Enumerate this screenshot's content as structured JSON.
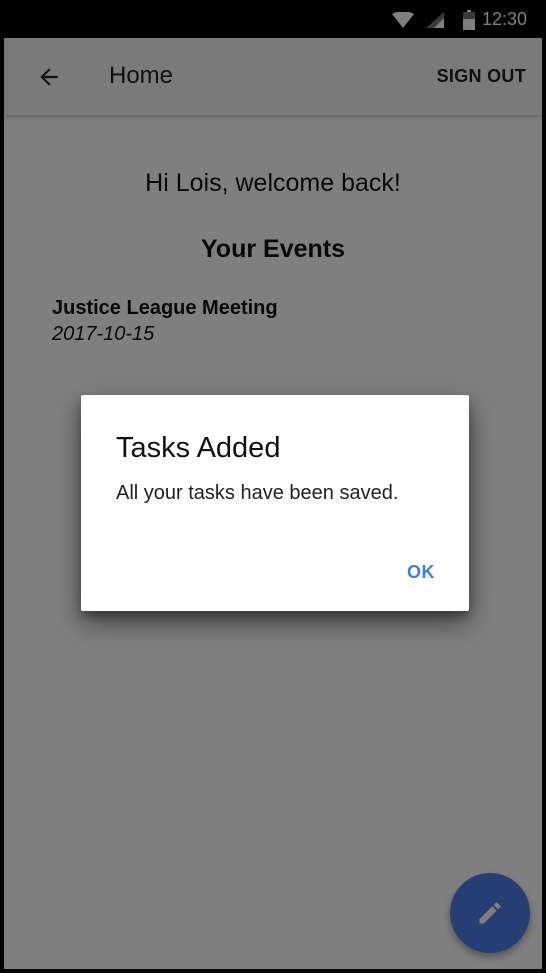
{
  "status_bar": {
    "time": "12:30",
    "icons": [
      "wifi-icon",
      "signal-icon",
      "battery-icon"
    ]
  },
  "app_bar": {
    "back_icon": "arrow-left-icon",
    "title": "Home",
    "sign_out_label": "SIGN OUT"
  },
  "main": {
    "welcome": "Hi Lois, welcome back!",
    "events_heading": "Your Events",
    "events": [
      {
        "name": "Justice League Meeting",
        "date": "2017-10-15"
      }
    ]
  },
  "dialog": {
    "title": "Tasks Added",
    "message": "All your tasks have been saved.",
    "ok_label": "OK"
  },
  "fab": {
    "icon": "pencil-icon"
  },
  "colors": {
    "accent": "#3b7ee0",
    "fab": "#4f7de9",
    "app_bar": "#f5f5f5",
    "scrim": "#000000"
  }
}
